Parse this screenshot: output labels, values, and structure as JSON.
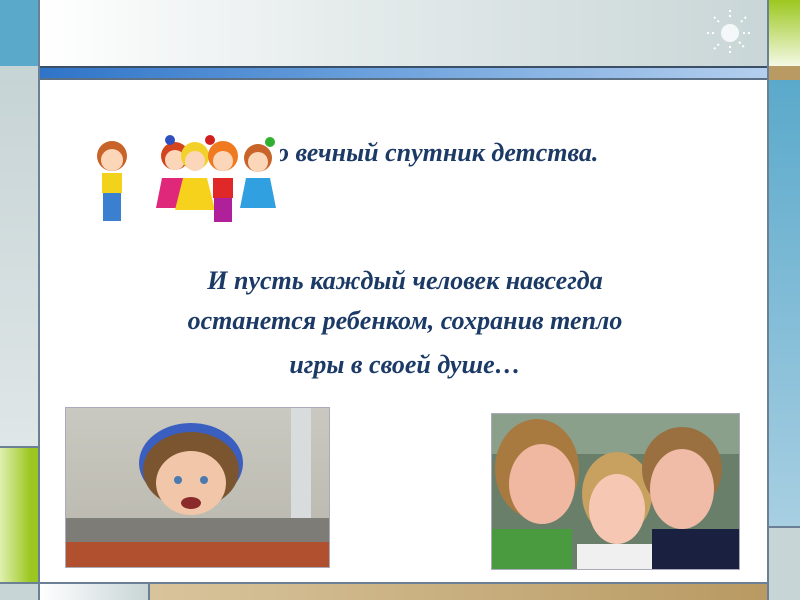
{
  "slide": {
    "line1": "о вечный спутник детства.",
    "paragraph": [
      "И пусть каждый человек навсегда",
      "останется ребенком, сохранив тепло",
      "игры в своей душе…"
    ]
  },
  "colors": {
    "text": "#1c3a66",
    "accent_blue": "#2f74c8",
    "accent_green": "#9cc720",
    "side_blue": "#5aa9cb"
  }
}
